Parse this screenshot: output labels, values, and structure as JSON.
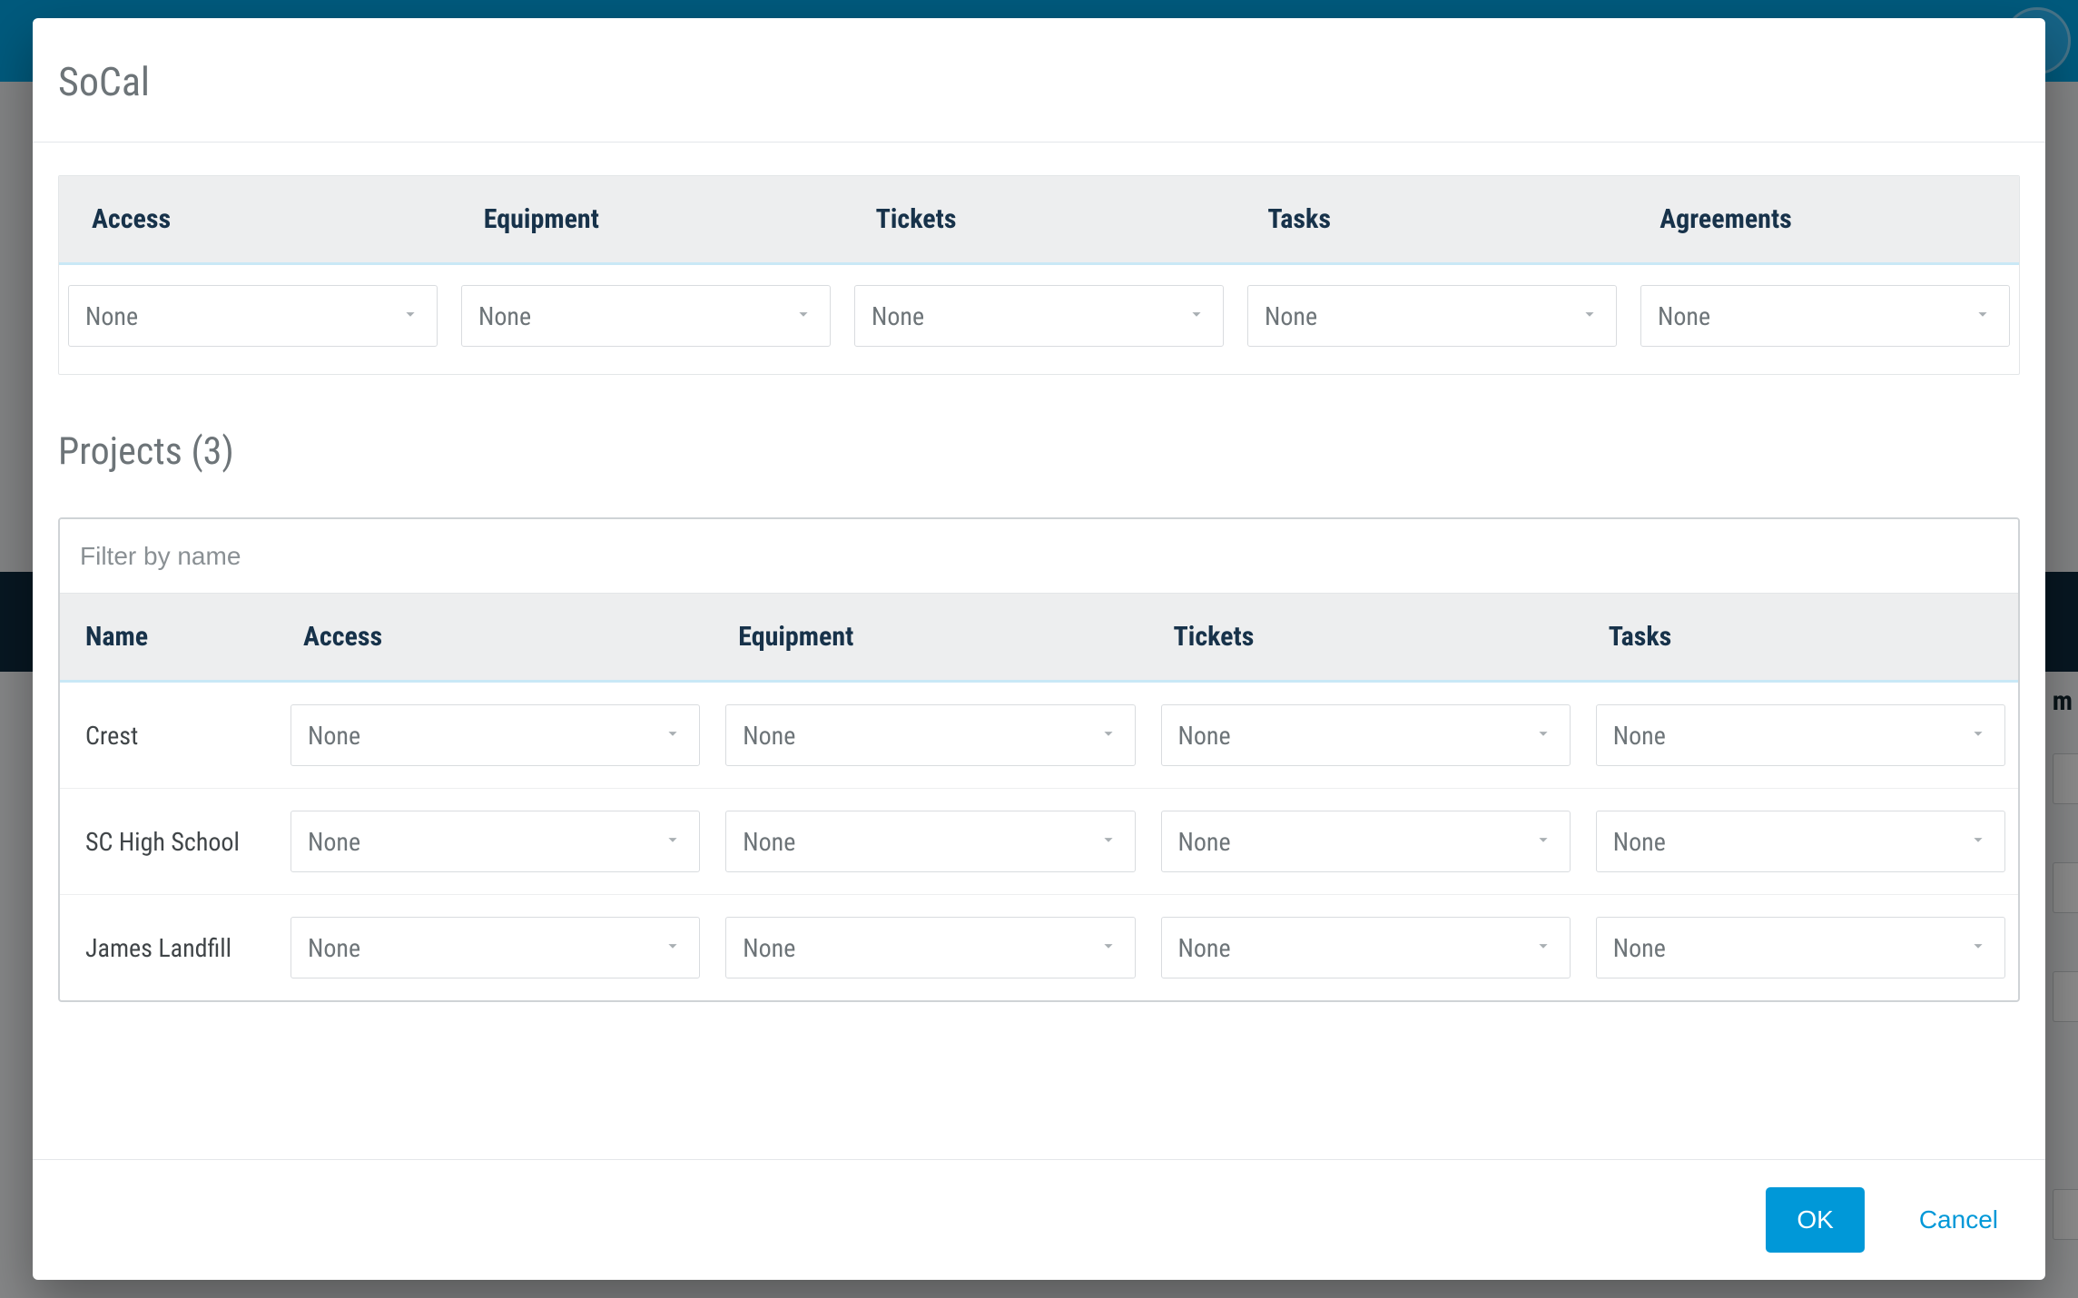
{
  "modal": {
    "title": "SoCal",
    "ok_label": "OK",
    "cancel_label": "Cancel"
  },
  "top_permissions": {
    "columns": [
      "Access",
      "Equipment",
      "Tickets",
      "Tasks",
      "Agreements"
    ],
    "values": [
      "None",
      "None",
      "None",
      "None",
      "None"
    ]
  },
  "projects": {
    "heading": "Projects (3)",
    "filter_placeholder": "Filter by name",
    "columns": [
      "Name",
      "Access",
      "Equipment",
      "Tickets",
      "Tasks"
    ],
    "rows": [
      {
        "name": "Crest",
        "access": "None",
        "equipment": "None",
        "tickets": "None",
        "tasks": "None"
      },
      {
        "name": "SC High School",
        "access": "None",
        "equipment": "None",
        "tickets": "None",
        "tasks": "None"
      },
      {
        "name": "James Landfill",
        "access": "None",
        "equipment": "None",
        "tickets": "None",
        "tasks": "None"
      }
    ]
  },
  "background_fragment": "m"
}
